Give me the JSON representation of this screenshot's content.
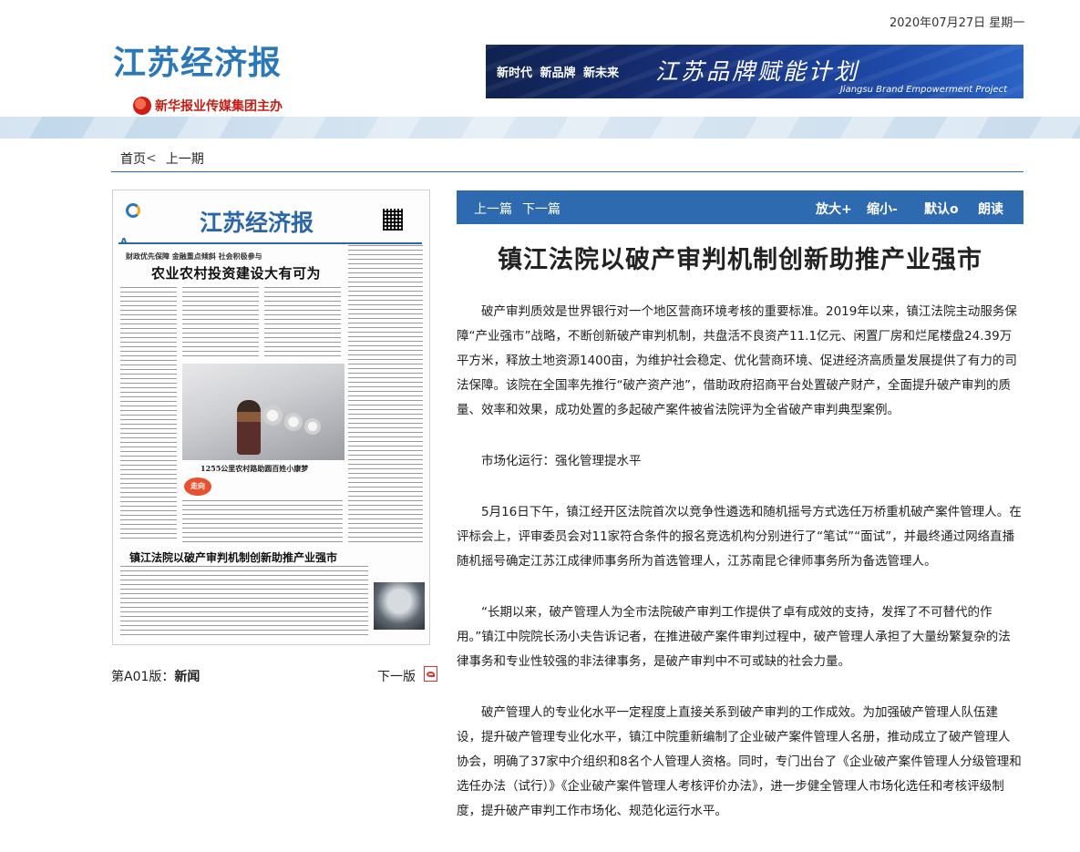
{
  "header": {
    "date": "2020年07月27日 星期一",
    "logo": "江苏经济报",
    "sponsor": "新华报业传媒集团主办",
    "banner": {
      "slogan": "新时代  新品牌  新未来",
      "title": "江苏品牌赋能计划",
      "subtitle": "Jiangsu Brand Empowerment Project"
    }
  },
  "nav": {
    "home": "首页",
    "sep": "<",
    "prev_issue": "上一期"
  },
  "page_image": {
    "masthead": "江苏经济报",
    "edition": "A",
    "kicker": "财政优先保障 金融重点倾斜 社会积极参与",
    "headline": "农业农村投资建设大有可为",
    "subhead": "1255公里农村路助圆百姓小康梦",
    "badge": "走向",
    "lead_title": "镇江法院以破产审判机制创新助推产业强市"
  },
  "page_caption": {
    "prefix": "第A01版：",
    "section": "新闻",
    "next_page": "下一版"
  },
  "toolbar": {
    "prev_article": "上一篇",
    "next_article": "下一篇",
    "zoom_in": "放大+",
    "zoom_out": "缩小-",
    "default": "默认o",
    "read_aloud": "朗读"
  },
  "article": {
    "title": "镇江法院以破产审判机制创新助推产业强市",
    "paragraphs": [
      "破产审判质效是世界银行对一个地区营商环境考核的重要标准。2019年以来，镇江法院主动服务保障“产业强市”战略，不断创新破产审判机制，共盘活不良资产11.1亿元、闲置厂房和烂尾楼盘24.39万平方米，释放土地资源1400亩，为维护社会稳定、优化营商环境、促进经济高质量发展提供了有力的司法保障。该院在全国率先推行“破产资产池”，借助政府招商平台处置破产财产，全面提升破产审判的质量、效率和效果，成功处置的多起破产案件被省法院评为全省破产审判典型案例。",
      "市场化运行：强化管理提水平",
      "5月16日下午，镇江经开区法院首次以竞争性遴选和随机摇号方式选任万桥重机破产案件管理人。在评标会上，评审委员会对11家符合条件的报名竞选机构分别进行了“笔试”“面试”，并最终通过网络直播随机摇号确定江苏江成律师事务所为首选管理人，江苏南昆仑律师事务所为备选管理人。",
      "“长期以来，破产管理人为全市法院破产审判工作提供了卓有成效的支持，发挥了不可替代的作用。”镇江中院院长汤小夫告诉记者，在推进破产案件审判过程中，破产管理人承担了大量纷繁复杂的法律事务和专业性较强的非法律事务，是破产审判中不可或缺的社会力量。",
      "破产管理人的专业化水平一定程度上直接关系到破产审判的工作成效。为加强破产管理人队伍建设，提升破产管理专业化水平，镇江中院重新编制了企业破产案件管理人名册，推动成立了破产管理人协会，明确了37家中介组织和8名个人管理人资格。同时，专门出台了《企业破产案件管理人分级管理和选任办法（试行）》《企业破产案件管理人考核评价办法》，进一步健全管理人市场化选任和考核评级制度，提升破产审判工作市场化、规范化运行水平。"
    ]
  }
}
